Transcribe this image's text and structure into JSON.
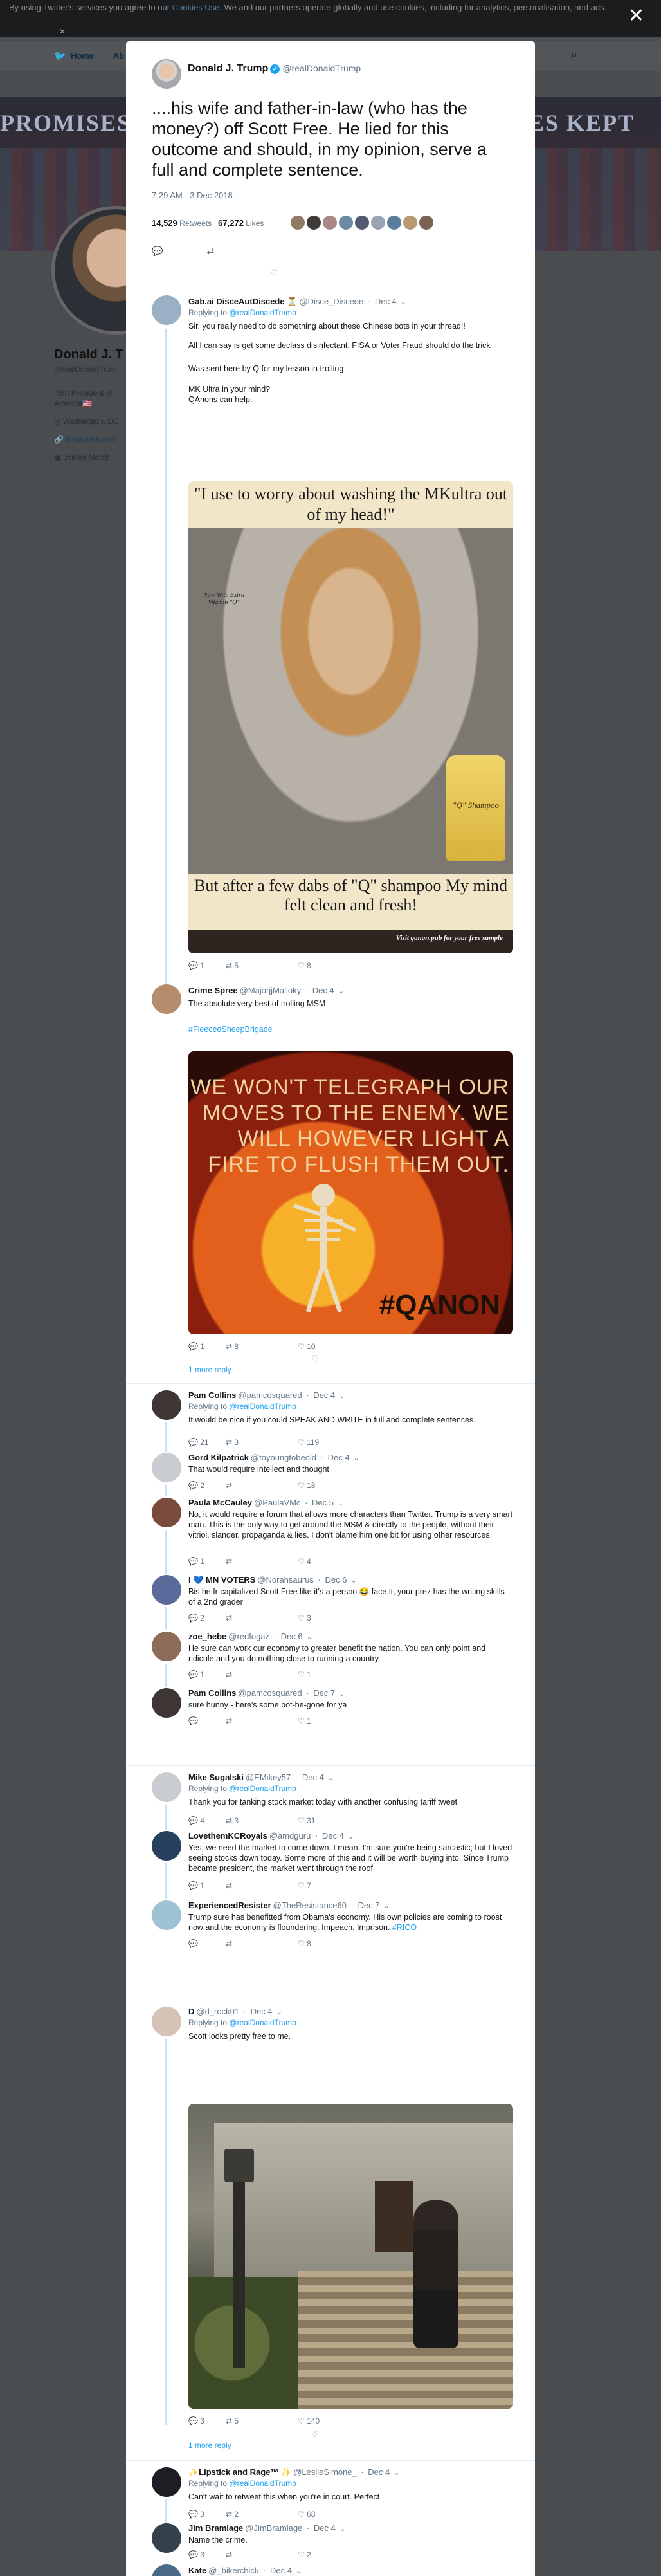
{
  "cookie": {
    "text": "By using Twitter's services you agree to our",
    "link": "Cookies Use",
    "rest": ". We and our partners operate globally and use cookies, including for analytics, personalisation, and ads."
  },
  "background": {
    "nav_home": "Home",
    "nav_more": "Ab",
    "banner_left": "PROMISES M",
    "banner_right": "SES KEPT",
    "profile_name": "Donald J. T",
    "profile_handle": "@realDonaldTrum",
    "bio_line1": "45th President of",
    "bio_line2": "America🇺🇸",
    "location": "Washington, DC",
    "website": "Instagram.com",
    "joined": "Joined March"
  },
  "tweet": {
    "name": "Donald J. Trump",
    "handle": "@realDonaldTrump",
    "text": "....his wife and father-in-law (who has the money?) off Scott Free. He lied for this outcome and should, in my opinion, serve a full and complete sentence.",
    "time": "7:29 AM - 3 Dec 2018",
    "retweets": "14,529",
    "retweets_label": "Retweets",
    "likes": "67,272",
    "likes_label": "Likes"
  },
  "replies": [
    {
      "name": "Gab.ai DisceAutDiscede ⏳",
      "handle": "@Disce_Discede",
      "date": "Dec 4",
      "replying": "Replying to",
      "replying_to": "@realDonaldTrump",
      "lines": [
        "Sir, you really need to do something about these Chinese bots in your thread!!",
        "All I can say is get some declass disinfectant, FISA or Voter Fraud should do the trick",
        "-----------------------",
        "Was sent here by Q for my lesson in trolling",
        "MK Ultra in your mind?",
        "QAnons can help:"
      ],
      "image_top": "\"I use to worry about washing the MKultra out of my head!\"",
      "image_bottom": "But after a few dabs of \"Q\" shampoo My mind felt clean and fresh!",
      "image_footer": "Visit qanon.pub for your free sample",
      "image_stamp": "Now With Extra Vitamin \"Q\"",
      "image_bottle": "\"Q\" Shampoo",
      "replies": "1",
      "retweets": "5",
      "likes": "8"
    },
    {
      "name": "Crime Spree",
      "handle": "@MajorjjMalloky",
      "date": "Dec 4",
      "text": "The absolute very best of trolling MSM",
      "hashtag": "#FleecedSheepBrigade",
      "image_text": "WE WON'T TELEGRAPH OUR MOVES TO THE ENEMY. WE WILL HOWEVER LIGHT A FIRE TO FLUSH THEM OUT.",
      "image_tag": "#QANON",
      "replies": "1",
      "retweets": "8",
      "likes": "10",
      "more": "1 more reply"
    },
    {
      "name": "Pam Collins",
      "handle": "@pamcosquared",
      "date": "Dec 4",
      "replying": "Replying to",
      "replying_to": "@realDonaldTrump",
      "text": "It would be nice if you could SPEAK AND WRITE in full and complete sentences.",
      "replies": "21",
      "retweets": "3",
      "likes": "119"
    },
    {
      "name": "Gord Kilpatrick",
      "handle": "@toyoungtobeold",
      "date": "Dec 4",
      "text": "That would require intellect and thought",
      "replies": "2",
      "retweets": "",
      "likes": "18"
    },
    {
      "name": "Paula McCauley",
      "handle": "@PaulaVMc",
      "date": "Dec 5",
      "text": "No, it would require a forum that allows more characters than Twitter. Trump is a very smart man. This is the only way to get around the MSM & directly to the people, without their vitriol, slander, propaganda & lies. I don't blame him one bit for using other resources.",
      "replies": "1",
      "retweets": "",
      "likes": "4"
    },
    {
      "name": "I 💙 MN VOTERS",
      "handle": "@Norahsaurus",
      "date": "Dec 6",
      "text": "Bis he fr capitalized Scott Free like it's a person 😂 face it, your prez has the writing skills of a 2nd grader",
      "replies": "2",
      "retweets": "",
      "likes": "3"
    },
    {
      "name": "zoe_hebe",
      "handle": "@redfogaz",
      "date": "Dec 6",
      "text": "He sure can work our economy to greater benefit the nation. You can only point and ridicule and you do nothing close to running a country.",
      "replies": "1",
      "retweets": "",
      "likes": "1"
    },
    {
      "name": "Pam Collins",
      "handle": "@pamcosquared",
      "date": "Dec 7",
      "text": "sure hunny - here's some bot-be-gone for ya",
      "replies": "",
      "retweets": "",
      "likes": "1"
    },
    {
      "name": "Mike Sugalski",
      "handle": "@EMikey57",
      "date": "Dec 4",
      "replying": "Replying to",
      "replying_to": "@realDonaldTrump",
      "text": "Thank you for tanking stock market today with another confusing tariff tweet",
      "replies": "4",
      "retweets": "3",
      "likes": "31"
    },
    {
      "name": "LovethemKCRoyals",
      "handle": "@amdguru",
      "date": "Dec 4",
      "text": "Yes, we need the market to come down. I mean, I'm sure you're being sarcastic; but I loved seeing stocks down today.  Some more of this and it will be worth buying into.  Since Trump became president, the market went through the roof",
      "replies": "1",
      "retweets": "",
      "likes": "7"
    },
    {
      "name": "ExperiencedResister",
      "handle": "@TheResistance60",
      "date": "Dec 7",
      "text": "Trump sure has benefitted from Obama's economy. His own policies are coming to roost now and the economy is floundering. Impeach. Imprison.",
      "hashtag": "#RICO",
      "replies": "",
      "retweets": "",
      "likes": "8"
    },
    {
      "name": "D",
      "handle": "@d_rock01",
      "date": "Dec 4",
      "replying": "Replying to",
      "replying_to": "@realDonaldTrump",
      "text": "Scott looks pretty free to me.",
      "replies": "3",
      "retweets": "5",
      "likes": "140",
      "more": "1 more reply"
    },
    {
      "name": "✨Lipstick and Rage™ ✨",
      "handle": "@LeslieSimone_",
      "date": "Dec 4",
      "replying": "Replying to",
      "replying_to": "@realDonaldTrump",
      "text": "Can't wait to retweet this when you're in court. Perfect",
      "replies": "3",
      "retweets": "2",
      "likes": "68"
    },
    {
      "name": "Jim Bramlage",
      "handle": "@JimBramlage",
      "date": "Dec 4",
      "text": "Name the crime.",
      "replies": "3",
      "retweets": "",
      "likes": "2"
    },
    {
      "name": "Kate",
      "handle": "@_bikerchick",
      "date": "Dec 4",
      "text": "",
      "replies": "",
      "retweets": "",
      "likes": ""
    }
  ],
  "colors": {
    "accent": "#1da1f2",
    "muted": "#657786",
    "text": "#14171a"
  }
}
